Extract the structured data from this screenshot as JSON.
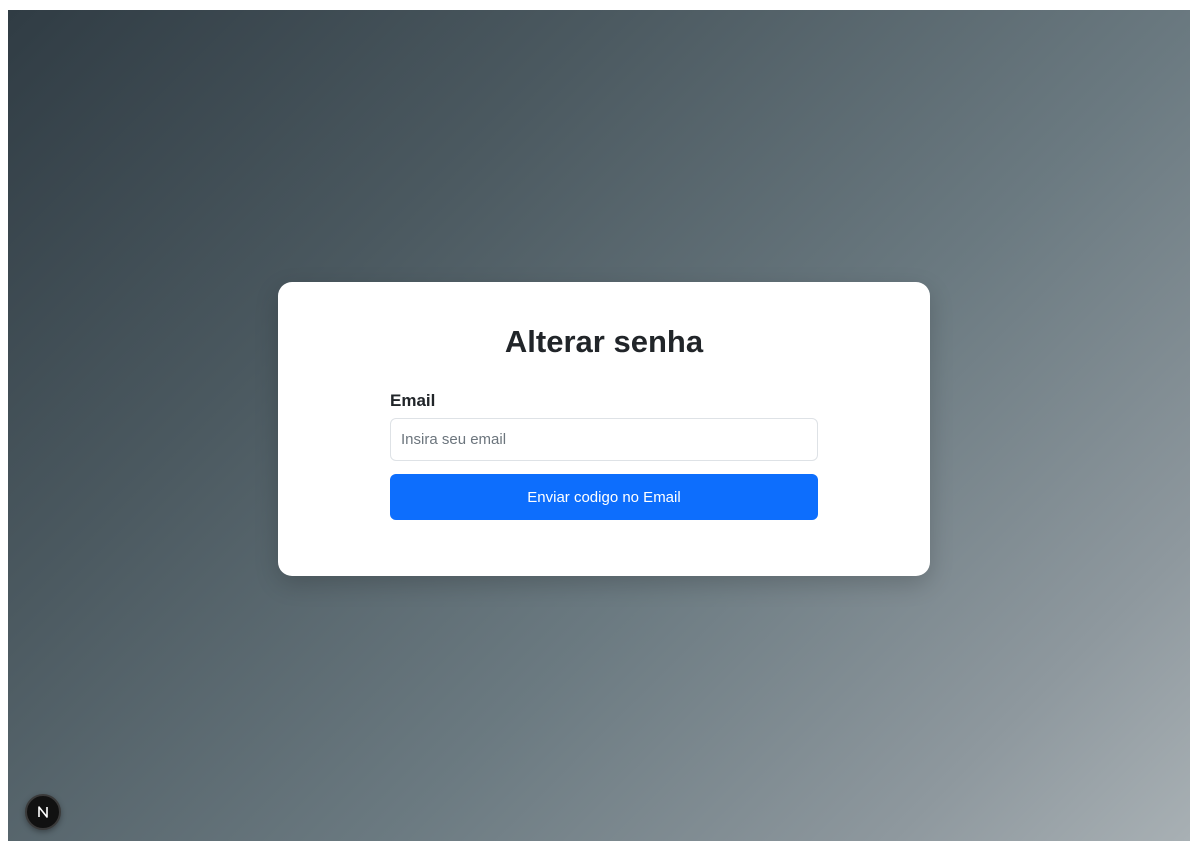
{
  "form": {
    "title": "Alterar senha",
    "email_label": "Email",
    "email_placeholder": "Insira seu email",
    "email_value": "",
    "submit_label": "Enviar codigo no Email"
  },
  "dev_indicator": {
    "icon": "nextjs-logo-icon",
    "letter": "N"
  },
  "colors": {
    "primary_button": "#0d6efd",
    "card_background": "#ffffff",
    "title_text": "#212529",
    "background_gradient_start": "#303c44",
    "background_gradient_end": "#a8b0b4",
    "badge_background": "#111111"
  }
}
